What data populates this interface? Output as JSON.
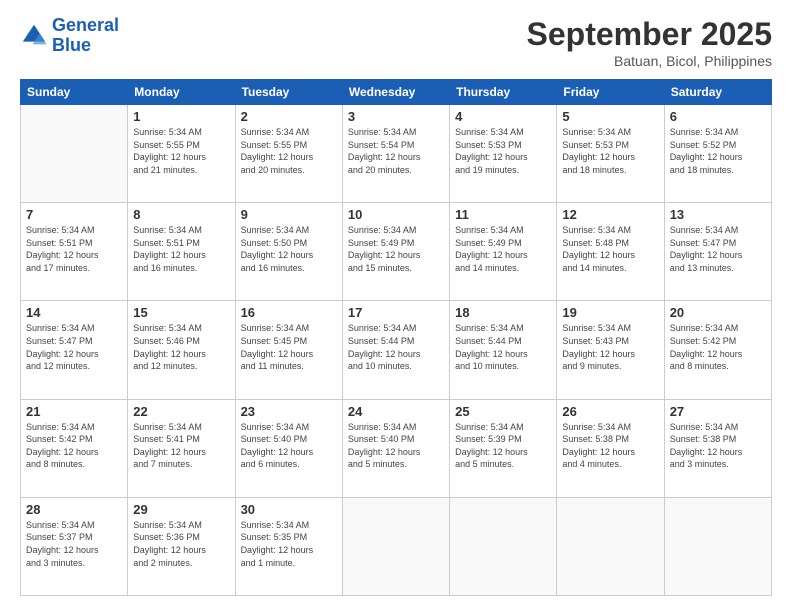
{
  "header": {
    "logo_line1": "General",
    "logo_line2": "Blue",
    "title": "September 2025",
    "subtitle": "Batuan, Bicol, Philippines"
  },
  "days_of_week": [
    "Sunday",
    "Monday",
    "Tuesday",
    "Wednesday",
    "Thursday",
    "Friday",
    "Saturday"
  ],
  "weeks": [
    [
      {
        "day": "",
        "info": ""
      },
      {
        "day": "1",
        "info": "Sunrise: 5:34 AM\nSunset: 5:55 PM\nDaylight: 12 hours\nand 21 minutes."
      },
      {
        "day": "2",
        "info": "Sunrise: 5:34 AM\nSunset: 5:55 PM\nDaylight: 12 hours\nand 20 minutes."
      },
      {
        "day": "3",
        "info": "Sunrise: 5:34 AM\nSunset: 5:54 PM\nDaylight: 12 hours\nand 20 minutes."
      },
      {
        "day": "4",
        "info": "Sunrise: 5:34 AM\nSunset: 5:53 PM\nDaylight: 12 hours\nand 19 minutes."
      },
      {
        "day": "5",
        "info": "Sunrise: 5:34 AM\nSunset: 5:53 PM\nDaylight: 12 hours\nand 18 minutes."
      },
      {
        "day": "6",
        "info": "Sunrise: 5:34 AM\nSunset: 5:52 PM\nDaylight: 12 hours\nand 18 minutes."
      }
    ],
    [
      {
        "day": "7",
        "info": "Sunrise: 5:34 AM\nSunset: 5:51 PM\nDaylight: 12 hours\nand 17 minutes."
      },
      {
        "day": "8",
        "info": "Sunrise: 5:34 AM\nSunset: 5:51 PM\nDaylight: 12 hours\nand 16 minutes."
      },
      {
        "day": "9",
        "info": "Sunrise: 5:34 AM\nSunset: 5:50 PM\nDaylight: 12 hours\nand 16 minutes."
      },
      {
        "day": "10",
        "info": "Sunrise: 5:34 AM\nSunset: 5:49 PM\nDaylight: 12 hours\nand 15 minutes."
      },
      {
        "day": "11",
        "info": "Sunrise: 5:34 AM\nSunset: 5:49 PM\nDaylight: 12 hours\nand 14 minutes."
      },
      {
        "day": "12",
        "info": "Sunrise: 5:34 AM\nSunset: 5:48 PM\nDaylight: 12 hours\nand 14 minutes."
      },
      {
        "day": "13",
        "info": "Sunrise: 5:34 AM\nSunset: 5:47 PM\nDaylight: 12 hours\nand 13 minutes."
      }
    ],
    [
      {
        "day": "14",
        "info": "Sunrise: 5:34 AM\nSunset: 5:47 PM\nDaylight: 12 hours\nand 12 minutes."
      },
      {
        "day": "15",
        "info": "Sunrise: 5:34 AM\nSunset: 5:46 PM\nDaylight: 12 hours\nand 12 minutes."
      },
      {
        "day": "16",
        "info": "Sunrise: 5:34 AM\nSunset: 5:45 PM\nDaylight: 12 hours\nand 11 minutes."
      },
      {
        "day": "17",
        "info": "Sunrise: 5:34 AM\nSunset: 5:44 PM\nDaylight: 12 hours\nand 10 minutes."
      },
      {
        "day": "18",
        "info": "Sunrise: 5:34 AM\nSunset: 5:44 PM\nDaylight: 12 hours\nand 10 minutes."
      },
      {
        "day": "19",
        "info": "Sunrise: 5:34 AM\nSunset: 5:43 PM\nDaylight: 12 hours\nand 9 minutes."
      },
      {
        "day": "20",
        "info": "Sunrise: 5:34 AM\nSunset: 5:42 PM\nDaylight: 12 hours\nand 8 minutes."
      }
    ],
    [
      {
        "day": "21",
        "info": "Sunrise: 5:34 AM\nSunset: 5:42 PM\nDaylight: 12 hours\nand 8 minutes."
      },
      {
        "day": "22",
        "info": "Sunrise: 5:34 AM\nSunset: 5:41 PM\nDaylight: 12 hours\nand 7 minutes."
      },
      {
        "day": "23",
        "info": "Sunrise: 5:34 AM\nSunset: 5:40 PM\nDaylight: 12 hours\nand 6 minutes."
      },
      {
        "day": "24",
        "info": "Sunrise: 5:34 AM\nSunset: 5:40 PM\nDaylight: 12 hours\nand 5 minutes."
      },
      {
        "day": "25",
        "info": "Sunrise: 5:34 AM\nSunset: 5:39 PM\nDaylight: 12 hours\nand 5 minutes."
      },
      {
        "day": "26",
        "info": "Sunrise: 5:34 AM\nSunset: 5:38 PM\nDaylight: 12 hours\nand 4 minutes."
      },
      {
        "day": "27",
        "info": "Sunrise: 5:34 AM\nSunset: 5:38 PM\nDaylight: 12 hours\nand 3 minutes."
      }
    ],
    [
      {
        "day": "28",
        "info": "Sunrise: 5:34 AM\nSunset: 5:37 PM\nDaylight: 12 hours\nand 3 minutes."
      },
      {
        "day": "29",
        "info": "Sunrise: 5:34 AM\nSunset: 5:36 PM\nDaylight: 12 hours\nand 2 minutes."
      },
      {
        "day": "30",
        "info": "Sunrise: 5:34 AM\nSunset: 5:35 PM\nDaylight: 12 hours\nand 1 minute."
      },
      {
        "day": "",
        "info": ""
      },
      {
        "day": "",
        "info": ""
      },
      {
        "day": "",
        "info": ""
      },
      {
        "day": "",
        "info": ""
      }
    ]
  ]
}
